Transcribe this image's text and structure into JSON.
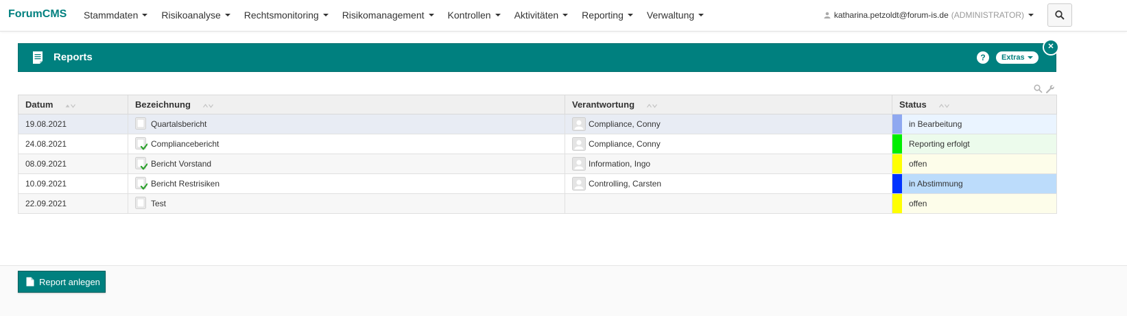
{
  "brand": {
    "part1": "Forum",
    "part2": "CMS"
  },
  "nav": {
    "items": [
      {
        "label": "Stammdaten"
      },
      {
        "label": "Risikoanalyse"
      },
      {
        "label": "Rechtsmonitoring"
      },
      {
        "label": "Risikomanagement"
      },
      {
        "label": "Kontrollen"
      },
      {
        "label": "Aktivitäten"
      },
      {
        "label": "Reporting"
      },
      {
        "label": "Verwaltung"
      }
    ],
    "user": {
      "email": "katharina.petzoldt@forum-is.de",
      "role": "(ADMINISTRATOR)"
    }
  },
  "panel": {
    "title": "Reports",
    "help_label": "?",
    "extras_label": "Extras",
    "close_label": "✕"
  },
  "table": {
    "headers": {
      "datum": "Datum",
      "bezeichnung": "Bezeichnung",
      "verantwortung": "Verantwortung",
      "status": "Status"
    },
    "rows": [
      {
        "datum": "19.08.2021",
        "bezeichnung": "Quartalsbericht",
        "verantwortung": "Compliance, Conny",
        "status": "in Bearbeitung",
        "status_color": "#8fa8f0",
        "status_bg": "#eaf4ff",
        "checked": false
      },
      {
        "datum": "24.08.2021",
        "bezeichnung": "Compliancebericht",
        "verantwortung": "Compliance, Conny",
        "status": "Reporting erfolgt",
        "status_color": "#00ee00",
        "status_bg": "#ecfbec",
        "checked": true
      },
      {
        "datum": "08.09.2021",
        "bezeichnung": "Bericht Vorstand",
        "verantwortung": "Information, Ingo",
        "status": "offen",
        "status_color": "#ffff00",
        "status_bg": "#fdfdea",
        "checked": true
      },
      {
        "datum": "10.09.2021",
        "bezeichnung": "Bericht Restrisiken",
        "verantwortung": "Controlling, Carsten",
        "status": "in Abstimmung",
        "status_color": "#0033ff",
        "status_bg": "#bcdcfb",
        "checked": true
      },
      {
        "datum": "22.09.2021",
        "bezeichnung": "Test",
        "verantwortung": "",
        "status": "offen",
        "status_color": "#ffff00",
        "status_bg": "#fdfdea",
        "checked": false
      }
    ]
  },
  "footer": {
    "create_label": "Report anlegen"
  },
  "colors": {
    "accent": "#00807f",
    "check": "#2ea32e"
  }
}
